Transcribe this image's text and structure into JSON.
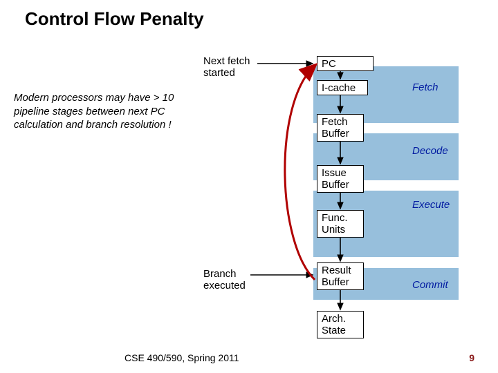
{
  "title": "Control Flow Penalty",
  "body_text": "Modern processors may have > 10 pipeline stages between next PC calculation and branch resolution !",
  "labels": {
    "next_fetch": "Next fetch\nstarted",
    "branch_executed": "Branch\nexecuted"
  },
  "stages": {
    "fetch": "Fetch",
    "decode": "Decode",
    "execute": "Execute",
    "commit": "Commit"
  },
  "boxes": {
    "pc": "PC",
    "icache": "I-cache",
    "fetch_buffer": "Fetch\nBuffer",
    "issue_buffer": "Issue\nBuffer",
    "func_units": "Func.\nUnits",
    "result_buffer": "Result\nBuffer",
    "arch_state": "Arch.\nState"
  },
  "footer": {
    "course": "CSE 490/590, Spring 2011",
    "page": "9"
  }
}
